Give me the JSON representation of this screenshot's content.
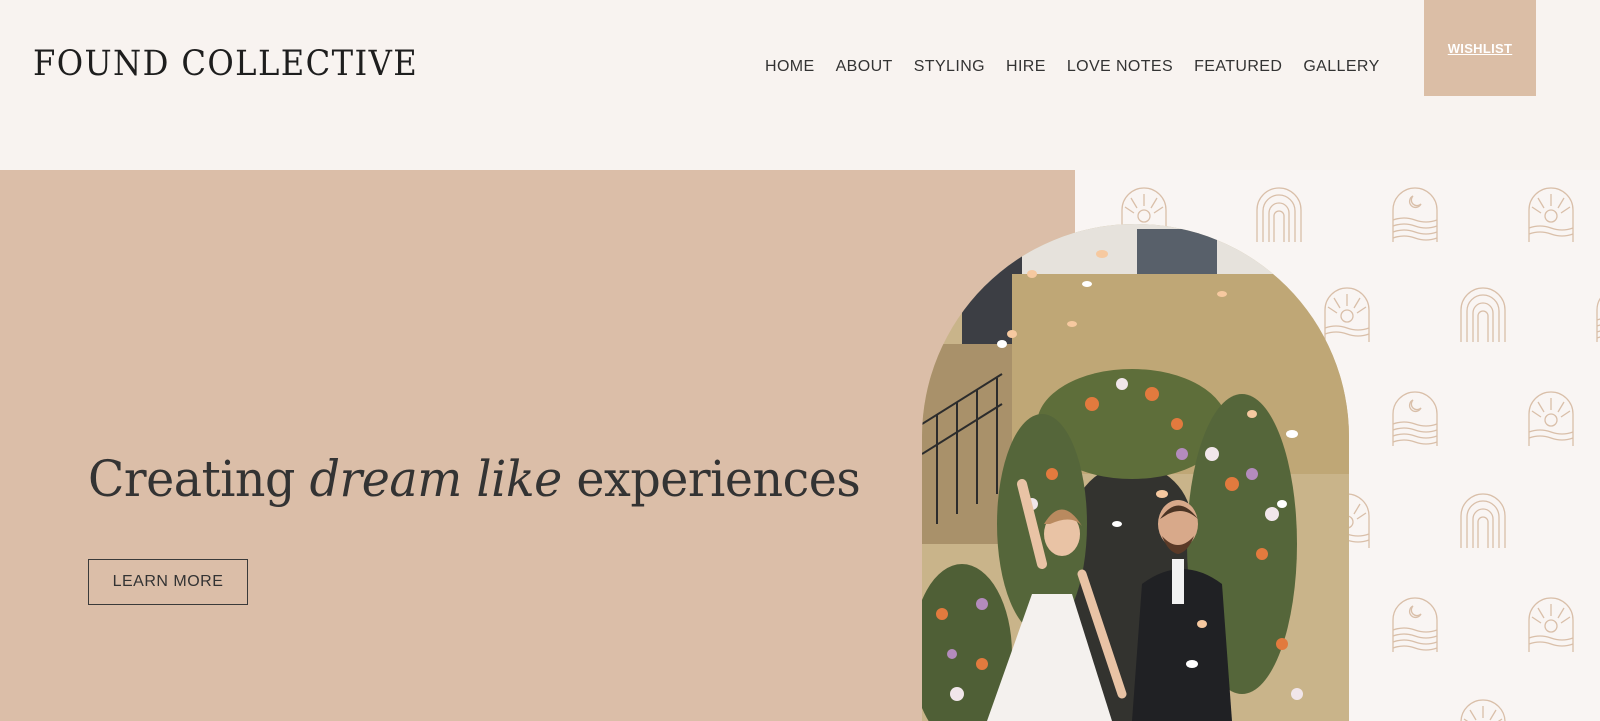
{
  "brand": {
    "logo": "FOUND COLLECTIVE"
  },
  "nav": {
    "items": [
      {
        "label": "HOME"
      },
      {
        "label": "ABOUT"
      },
      {
        "label": "STYLING"
      },
      {
        "label": "HIRE"
      },
      {
        "label": "LOVE NOTES"
      },
      {
        "label": "FEATURED"
      },
      {
        "label": "GALLERY"
      }
    ],
    "wishlist_label": "WISHLIST"
  },
  "hero": {
    "headline_start": "Creating ",
    "headline_italic": "dream like",
    "headline_end": " experiences",
    "cta_label": "LEARN MORE",
    "photo_icon": "wedding-couple-photo"
  },
  "colors": {
    "background": "#f8f3f0",
    "accent": "#dbbea8",
    "pattern_line": "#d9bfa9",
    "text": "#333333"
  }
}
